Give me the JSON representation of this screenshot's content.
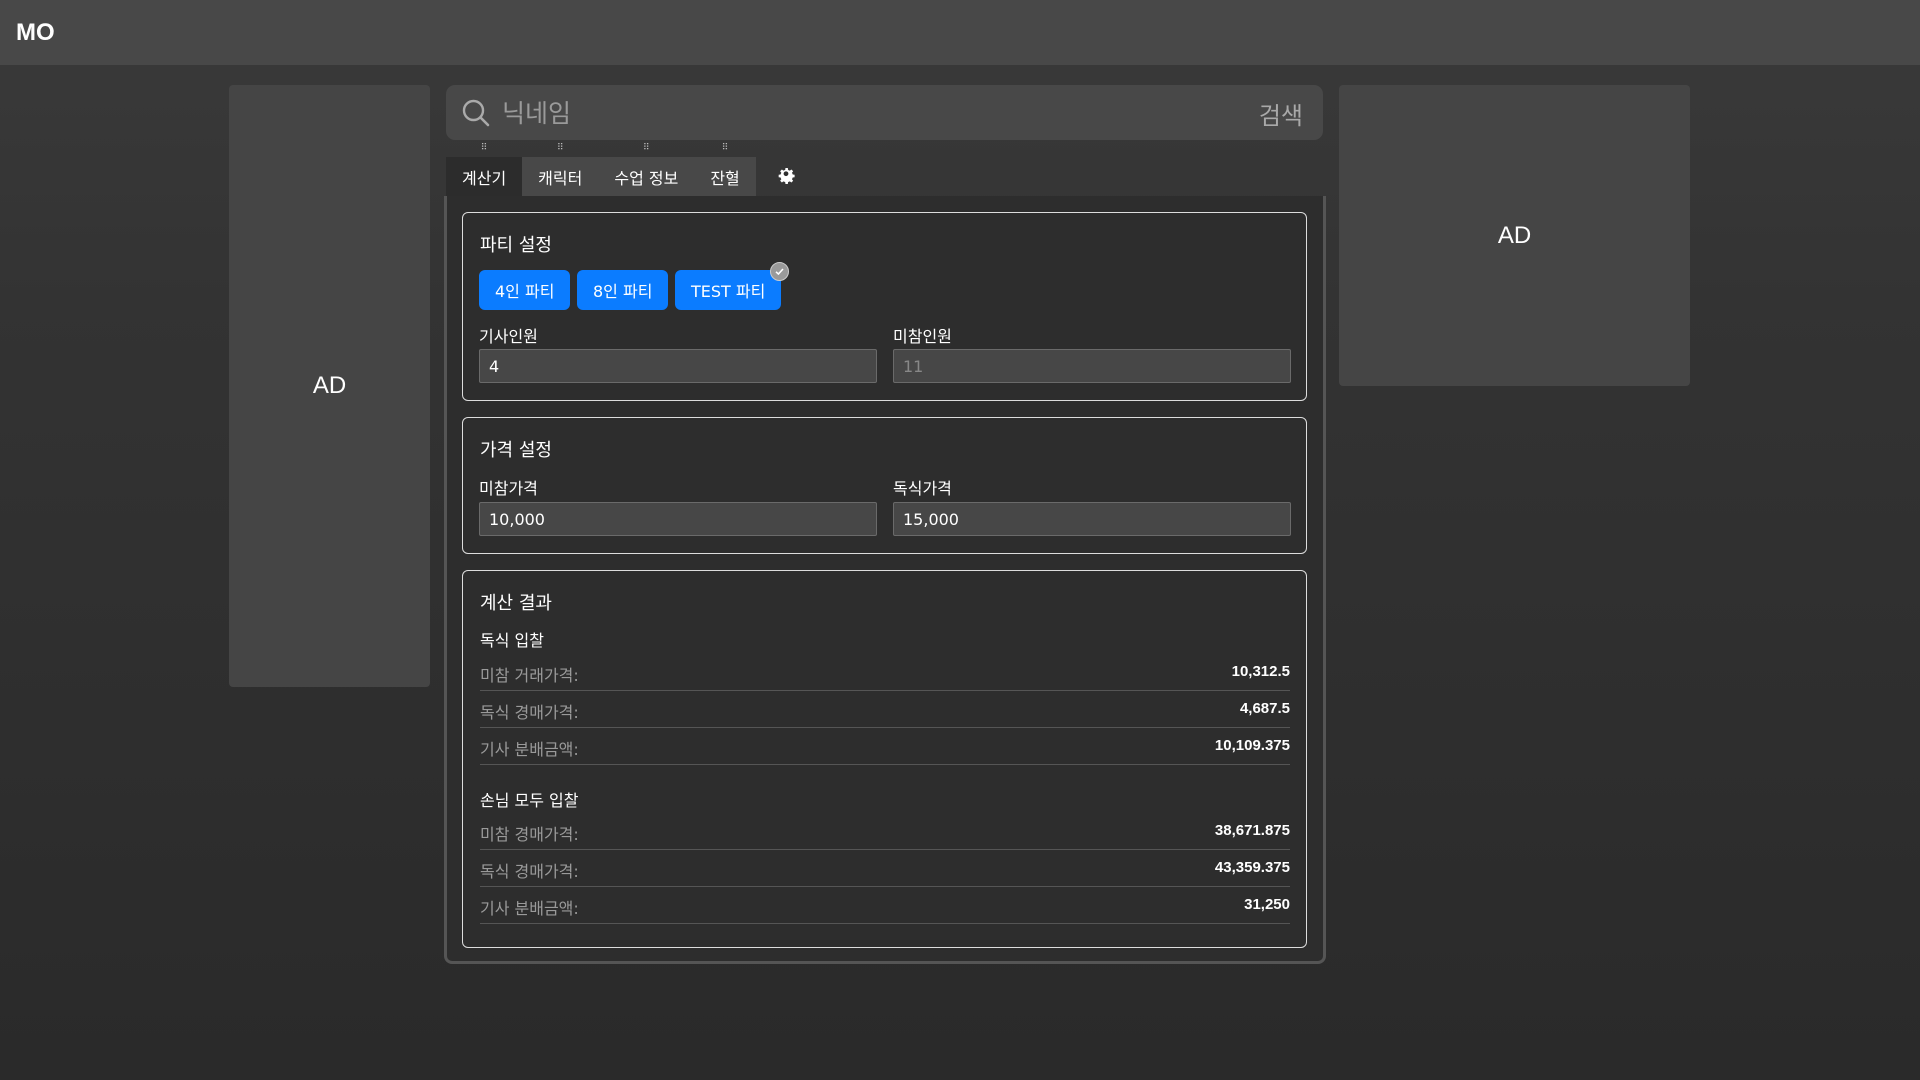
{
  "app": {
    "logo": "MO"
  },
  "ads": {
    "left": "AD",
    "right": "AD"
  },
  "search": {
    "placeholder": "닉네임",
    "button_label": "검색"
  },
  "tabs": [
    {
      "label": "계산기",
      "active": true
    },
    {
      "label": "캐릭터",
      "active": false
    },
    {
      "label": "수업 정보",
      "active": false
    },
    {
      "label": "잔혈",
      "active": false
    }
  ],
  "party": {
    "title": "파티 설정",
    "buttons": [
      {
        "label": "4인 파티",
        "selected": false
      },
      {
        "label": "8인 파티",
        "selected": false
      },
      {
        "label": "TEST 파티",
        "selected": true
      }
    ],
    "members_label": "기사인원",
    "members_value": "4",
    "absent_label": "미참인원",
    "absent_placeholder": "11"
  },
  "price": {
    "title": "가격 설정",
    "absent_price_label": "미참가격",
    "absent_price_value": "10,000",
    "solo_price_label": "독식가격",
    "solo_price_value": "15,000"
  },
  "result": {
    "title": "계산 결과",
    "sections": [
      {
        "title": "독식 입찰",
        "rows": [
          {
            "label": "미참 거래가격:",
            "value": "10,312.5"
          },
          {
            "label": "독식 경매가격:",
            "value": "4,687.5"
          },
          {
            "label": "기사 분배금액:",
            "value": "10,109.375"
          }
        ]
      },
      {
        "title": "손님 모두 입찰",
        "rows": [
          {
            "label": "미참 경매가격:",
            "value": "38,671.875"
          },
          {
            "label": "독식 경매가격:",
            "value": "43,359.375"
          },
          {
            "label": "기사 분배금액:",
            "value": "31,250"
          }
        ]
      }
    ]
  },
  "colors": {
    "accent": "#0b7cff",
    "background": "#333333",
    "topbar": "#484848",
    "ad": "#454545"
  },
  "icons": [
    "search-icon",
    "gear-icon",
    "check-icon",
    "drag-handle-icon"
  ]
}
